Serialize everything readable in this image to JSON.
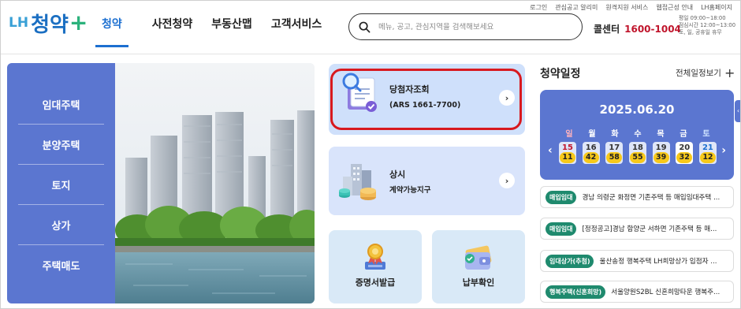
{
  "header": {
    "logo": {
      "lh": "LH",
      "main": "청약",
      "plus": "+"
    },
    "nav": [
      "청약",
      "사전청약",
      "부동산맵",
      "고객서비스"
    ],
    "search_placeholder": "메뉴, 공고, 관심지역을 검색해보세요",
    "utility_links": [
      "로그인",
      "관심공고 알리미",
      "원격지원 서비스",
      "웹접근성 안내",
      "LH홈페이지"
    ],
    "callcenter": {
      "label": "콜센터",
      "number": "1600-1004"
    },
    "hours": [
      "평일 09:00~18:00",
      "점심시간 12:00~13:00",
      "토, 일, 공휴일 휴무"
    ]
  },
  "side_menu": [
    "임대주택",
    "분양주택",
    "토지",
    "상가",
    "주택매도"
  ],
  "cards": {
    "winner": {
      "title": "당첨자조회",
      "subtitle": "(ARS 1661-7700)"
    },
    "contract": {
      "title": "상시",
      "subtitle": "계약가능지구"
    },
    "certificate": {
      "label": "증명서발급"
    },
    "payment": {
      "label": "납부확인"
    }
  },
  "schedule": {
    "title": "청약일정",
    "view_all": "전체일정보기",
    "date": "2025.06.20",
    "weekdays": [
      "일",
      "월",
      "화",
      "수",
      "목",
      "금",
      "토"
    ],
    "days": [
      {
        "date": "15",
        "count": "11"
      },
      {
        "date": "16",
        "count": "42"
      },
      {
        "date": "17",
        "count": "58"
      },
      {
        "date": "18",
        "count": "55"
      },
      {
        "date": "19",
        "count": "39"
      },
      {
        "date": "20",
        "count": "32"
      },
      {
        "date": "21",
        "count": "12"
      }
    ],
    "prev": "‹",
    "next": "›"
  },
  "notices": [
    {
      "badge": "매입임대",
      "text": "경남 의령군 화정면 기존주택 등 매입임대주택 ..."
    },
    {
      "badge": "매입임대",
      "text": "[정정공고]경남 함양군 서하면 기존주택 등 매..."
    },
    {
      "badge": "임대상가(추첨)",
      "text": "울산송정 행복주택 LH희망상가 입점자 ..."
    },
    {
      "badge": "행복주택(신혼희망)",
      "text": "서울양원S2BL 신혼희망타운 행복주..."
    }
  ],
  "colors": {
    "brand_blue": "#1c6fd0",
    "menu_blue": "#5b76d0",
    "highlight_red": "#d8191f",
    "badge_green": "#1f8a6e",
    "count_yellow": "#f7c81a"
  }
}
